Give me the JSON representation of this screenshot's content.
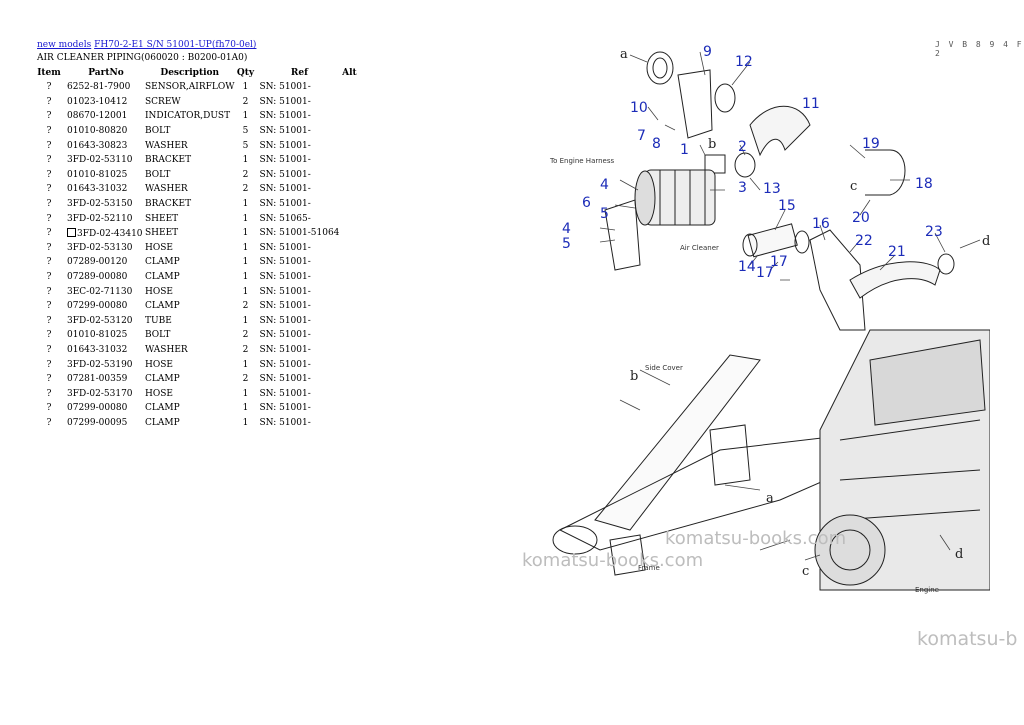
{
  "breadcrumb": {
    "link1": "new models",
    "link2": "FH70-2-E1 S/N 51001-UP(fh70-0el)"
  },
  "subtitle": "AIR CLEANER PIPING(060020 : B0200-01A0)",
  "columns": [
    "Item",
    "PartNo",
    "Description",
    "Qty",
    "Ref",
    "Alt"
  ],
  "rows": [
    {
      "item": "?",
      "part": "6252-81-7900",
      "desc": "SENSOR,AIRFLOW",
      "qty": "1",
      "ref": "SN: 51001-"
    },
    {
      "item": "?",
      "part": "01023-10412",
      "desc": "SCREW",
      "qty": "2",
      "ref": "SN: 51001-"
    },
    {
      "item": "?",
      "part": "08670-12001",
      "desc": "INDICATOR,DUST",
      "qty": "1",
      "ref": "SN: 51001-"
    },
    {
      "item": "?",
      "part": "01010-80820",
      "desc": "BOLT",
      "qty": "5",
      "ref": "SN: 51001-"
    },
    {
      "item": "?",
      "part": "01643-30823",
      "desc": "WASHER",
      "qty": "5",
      "ref": "SN: 51001-"
    },
    {
      "item": "?",
      "part": "3FD-02-53110",
      "desc": "BRACKET",
      "qty": "1",
      "ref": "SN: 51001-"
    },
    {
      "item": "?",
      "part": "01010-81025",
      "desc": "BOLT",
      "qty": "2",
      "ref": "SN: 51001-"
    },
    {
      "item": "?",
      "part": "01643-31032",
      "desc": "WASHER",
      "qty": "2",
      "ref": "SN: 51001-"
    },
    {
      "item": "?",
      "part": "3FD-02-53150",
      "desc": "BRACKET",
      "qty": "1",
      "ref": "SN: 51001-"
    },
    {
      "item": "?",
      "part": "3FD-02-52110",
      "desc": "SHEET",
      "qty": "1",
      "ref": "SN: 51065-"
    },
    {
      "item": "?",
      "part": "3FD-02-43410",
      "desc": "SHEET",
      "qty": "1",
      "ref": "SN: 51001-51064",
      "boxed": true
    },
    {
      "item": "?",
      "part": "3FD-02-53130",
      "desc": "HOSE",
      "qty": "1",
      "ref": "SN: 51001-"
    },
    {
      "item": "?",
      "part": "07289-00120",
      "desc": "CLAMP",
      "qty": "1",
      "ref": "SN: 51001-"
    },
    {
      "item": "?",
      "part": "07289-00080",
      "desc": "CLAMP",
      "qty": "1",
      "ref": "SN: 51001-"
    },
    {
      "item": "?",
      "part": "3EC-02-71130",
      "desc": "HOSE",
      "qty": "1",
      "ref": "SN: 51001-"
    },
    {
      "item": "?",
      "part": "07299-00080",
      "desc": "CLAMP",
      "qty": "2",
      "ref": "SN: 51001-"
    },
    {
      "item": "?",
      "part": "3FD-02-53120",
      "desc": "TUBE",
      "qty": "1",
      "ref": "SN: 51001-"
    },
    {
      "item": "?",
      "part": "01010-81025",
      "desc": "BOLT",
      "qty": "2",
      "ref": "SN: 51001-"
    },
    {
      "item": "?",
      "part": "01643-31032",
      "desc": "WASHER",
      "qty": "2",
      "ref": "SN: 51001-"
    },
    {
      "item": "?",
      "part": "3FD-02-53190",
      "desc": "HOSE",
      "qty": "1",
      "ref": "SN: 51001-"
    },
    {
      "item": "?",
      "part": "07281-00359",
      "desc": "CLAMP",
      "qty": "2",
      "ref": "SN: 51001-"
    },
    {
      "item": "?",
      "part": "3FD-02-53170",
      "desc": "HOSE",
      "qty": "1",
      "ref": "SN: 51001-"
    },
    {
      "item": "?",
      "part": "07299-00080",
      "desc": "CLAMP",
      "qty": "1",
      "ref": "SN: 51001-"
    },
    {
      "item": "?",
      "part": "07299-00095",
      "desc": "CLAMP",
      "qty": "1",
      "ref": "SN: 51001-"
    }
  ],
  "diagram": {
    "code": "J V B 8 9 4 F 2",
    "callouts": [
      "1",
      "2",
      "3",
      "4",
      "4",
      "5",
      "5",
      "6",
      "7",
      "8",
      "9",
      "10",
      "11",
      "12",
      "13",
      "14",
      "15",
      "16",
      "17",
      "18",
      "19",
      "20",
      "20",
      "21",
      "22",
      "23"
    ],
    "letters": [
      "a",
      "a",
      "b",
      "b",
      "c",
      "c",
      "d",
      "d"
    ],
    "labels": {
      "engine_harness": "To Engine Harness",
      "air_cleaner": "Air Cleaner",
      "side_cover": "Side Cover",
      "frame": "Frame",
      "engine": "Engine"
    }
  },
  "watermarks": [
    "komatsu-books.com",
    "komatsu-books.com",
    "komatsu-b"
  ]
}
